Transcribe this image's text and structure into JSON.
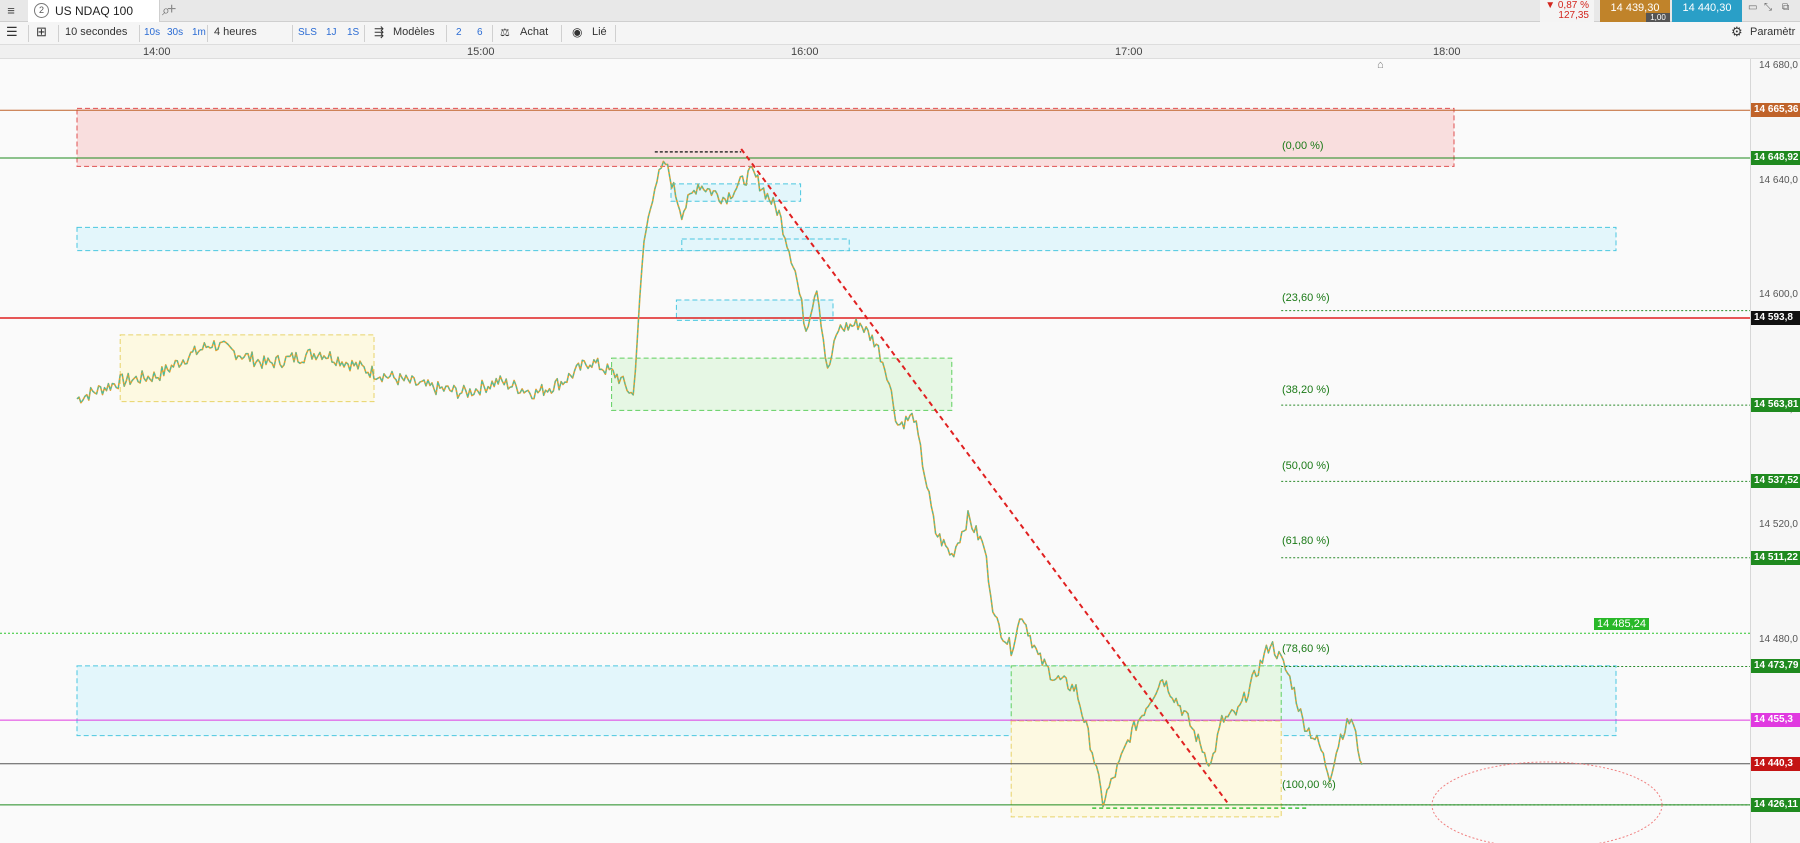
{
  "app": {
    "tab_number": "2",
    "tab_title": "US NDAQ 100",
    "icons": {
      "menu": "hamburger-icon",
      "search": "search-icon",
      "add_tab": "plus-icon"
    }
  },
  "quote": {
    "change_pct": "▼ 0,87 %",
    "change_abs": "127,35",
    "bid": "14 439,30",
    "ask": "14 440,30",
    "qty": "1,00",
    "colors": {
      "bid": "#c0832a",
      "ask": "#2a9fc7",
      "down": "#d3261e"
    }
  },
  "toolbar": {
    "interval": "10 secondes",
    "quick_intervals": [
      "10s",
      "30s",
      "1m"
    ],
    "period": "4 heures",
    "quick_periods": [
      "SLS",
      "1J",
      "1S"
    ],
    "models_label": "Modèles",
    "model_shortcuts": [
      "2",
      "6"
    ],
    "buy_label": "Achat",
    "linked_label": "Lié",
    "settings_label": "Paramètr"
  },
  "time_axis": {
    "labels": [
      "14:00",
      "15:00",
      "16:00",
      "17:00",
      "18:00"
    ]
  },
  "price_axis": {
    "ticks": [
      "14 680,0",
      "14 640,0",
      "14 600,0",
      "14 560,0",
      "14 520,0",
      "14 480,0"
    ],
    "badges": [
      {
        "label": "14 665,36",
        "price": 14665.36,
        "color": "#c0632a"
      },
      {
        "label": "14 648,92",
        "price": 14648.92,
        "color": "#1f8a1f"
      },
      {
        "label": "14 593,8",
        "price": 14593.8,
        "color": "#111111"
      },
      {
        "label": "14 563,81",
        "price": 14563.81,
        "color": "#1f8a1f"
      },
      {
        "label": "14 537,52",
        "price": 14537.52,
        "color": "#1f8a1f"
      },
      {
        "label": "14 511,22",
        "price": 14511.22,
        "color": "#1f8a1f"
      },
      {
        "label": "14 473,79",
        "price": 14473.79,
        "color": "#1f8a1f"
      },
      {
        "label": "14 455,3",
        "price": 14455.3,
        "color": "#e03ae0"
      },
      {
        "label": "14 440,3",
        "price": 14440.3,
        "color": "#c41414"
      },
      {
        "label": "14 426,11",
        "price": 14426.11,
        "color": "#1f8a1f"
      }
    ]
  },
  "chart_data": {
    "type": "line",
    "symbol": "US NDAQ 100",
    "x_range": [
      "13:45",
      "18:30"
    ],
    "ylim": [
      14413,
      14683
    ],
    "series": [
      {
        "values": [
          [
            "13:45",
            14566
          ],
          [
            "13:53",
            14572
          ],
          [
            "14:00",
            14574
          ],
          [
            "14:05",
            14580
          ],
          [
            "14:10",
            14585
          ],
          [
            "14:20",
            14578
          ],
          [
            "14:30",
            14582
          ],
          [
            "14:40",
            14575
          ],
          [
            "14:50",
            14570
          ],
          [
            "14:57",
            14568
          ],
          [
            "15:03",
            14572
          ],
          [
            "15:10",
            14568
          ],
          [
            "15:15",
            14572
          ],
          [
            "15:20",
            14579
          ],
          [
            "15:25",
            14574
          ],
          [
            "15:28",
            14567
          ],
          [
            "15:30",
            14620
          ],
          [
            "15:32",
            14640
          ],
          [
            "15:34",
            14647
          ],
          [
            "15:37",
            14630
          ],
          [
            "15:40",
            14640
          ],
          [
            "15:45",
            14635
          ],
          [
            "15:50",
            14644
          ],
          [
            "15:55",
            14630
          ],
          [
            "15:58",
            14610
          ],
          [
            "16:00",
            14590
          ],
          [
            "16:02",
            14605
          ],
          [
            "16:04",
            14575
          ],
          [
            "16:06",
            14590
          ],
          [
            "16:10",
            14592
          ],
          [
            "16:13",
            14585
          ],
          [
            "16:15",
            14575
          ],
          [
            "16:17",
            14557
          ],
          [
            "16:20",
            14560
          ],
          [
            "16:22",
            14540
          ],
          [
            "16:24",
            14520
          ],
          [
            "16:27",
            14512
          ],
          [
            "16:30",
            14525
          ],
          [
            "16:33",
            14515
          ],
          [
            "16:35",
            14490
          ],
          [
            "16:38",
            14480
          ],
          [
            "16:40",
            14492
          ],
          [
            "16:43",
            14477
          ],
          [
            "16:46",
            14470
          ],
          [
            "16:50",
            14466
          ],
          [
            "16:53",
            14445
          ],
          [
            "16:55",
            14427
          ],
          [
            "16:58",
            14440
          ],
          [
            "17:00",
            14450
          ],
          [
            "17:03",
            14460
          ],
          [
            "17:06",
            14470
          ],
          [
            "17:10",
            14458
          ],
          [
            "17:13",
            14447
          ],
          [
            "17:15",
            14440
          ],
          [
            "17:17",
            14455
          ],
          [
            "17:20",
            14458
          ],
          [
            "17:23",
            14470
          ],
          [
            "17:26",
            14482
          ],
          [
            "17:28",
            14476
          ],
          [
            "17:30",
            14468
          ],
          [
            "17:32",
            14455
          ],
          [
            "17:35",
            14447
          ],
          [
            "17:37",
            14436
          ],
          [
            "17:39",
            14450
          ],
          [
            "17:41",
            14456
          ],
          [
            "17:43",
            14440
          ]
        ]
      }
    ],
    "horizontal_lines": [
      {
        "price": 14665.36,
        "color": "#c0632a",
        "style": "solid"
      },
      {
        "price": 14648.92,
        "color": "#1f8a1f",
        "style": "solid"
      },
      {
        "price": 14593.8,
        "color": "#e02020",
        "style": "solid"
      },
      {
        "price": 14485.24,
        "color": "#2cc62c",
        "style": "dotted",
        "label": "14 485,24"
      },
      {
        "price": 14455.3,
        "color": "#e03ae0",
        "style": "solid"
      },
      {
        "price": 14440.3,
        "color": "#555555",
        "style": "solid"
      },
      {
        "price": 14426.11,
        "color": "#1f8a1f",
        "style": "solid"
      }
    ],
    "fibonacci": {
      "high": 14648.92,
      "low": 14426.11,
      "levels": [
        {
          "label": "(0,00 %)",
          "price": 14648.92
        },
        {
          "label": "(23,60 %)",
          "price": 14596.34
        },
        {
          "label": "(38,20 %)",
          "price": 14563.81
        },
        {
          "label": "(50,00 %)",
          "price": 14537.52
        },
        {
          "label": "(61,80 %)",
          "price": 14511.22
        },
        {
          "label": "(78,60 %)",
          "price": 14473.79
        },
        {
          "label": "(100,00 %)",
          "price": 14426.11
        }
      ]
    },
    "trendline": {
      "from": [
        "15:48",
        14652
      ],
      "to": [
        "17:18",
        14427
      ],
      "color": "#e02020"
    },
    "zones": [
      {
        "from": "13:45",
        "to": "18:00",
        "top": 14666,
        "bottom": 14646,
        "color": "red"
      },
      {
        "from": "13:45",
        "to": "18:30",
        "top": 14625,
        "bottom": 14617,
        "color": "cyan"
      },
      {
        "from": "13:45",
        "to": "18:30",
        "top": 14474,
        "bottom": 14450,
        "color": "cyan"
      },
      {
        "from": "15:35",
        "to": "15:59",
        "top": 14640,
        "bottom": 14634,
        "color": "cyan"
      },
      {
        "from": "15:37",
        "to": "16:08",
        "top": 14621,
        "bottom": 14617,
        "color": "cyan"
      },
      {
        "from": "15:36",
        "to": "16:05",
        "top": 14600,
        "bottom": 14593,
        "color": "cyan"
      },
      {
        "from": "13:53",
        "to": "14:40",
        "top": 14588,
        "bottom": 14565,
        "color": "yellow"
      },
      {
        "from": "15:24",
        "to": "16:27",
        "top": 14580,
        "bottom": 14562,
        "color": "green"
      },
      {
        "from": "16:38",
        "to": "17:28",
        "top": 14474,
        "bottom": 14455,
        "color": "green"
      },
      {
        "from": "16:38",
        "to": "17:28",
        "top": 14455,
        "bottom": 14422,
        "color": "yellow"
      }
    ],
    "grid": false
  }
}
